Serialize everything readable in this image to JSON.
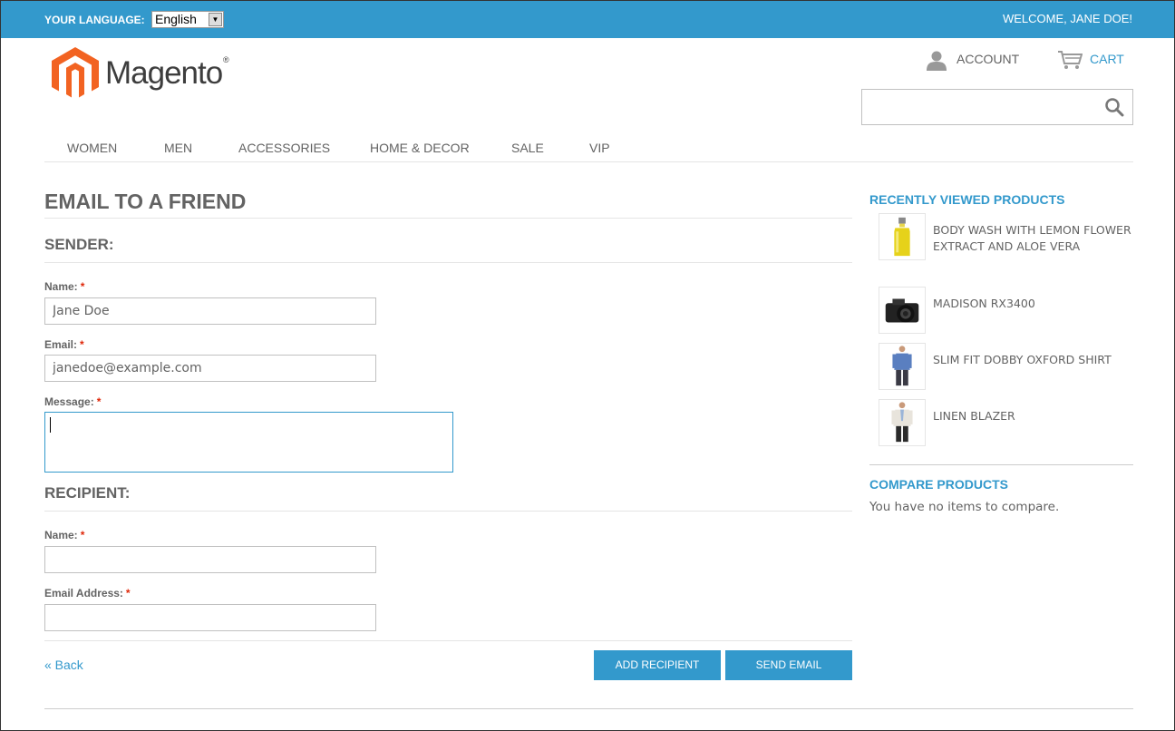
{
  "topbar": {
    "language_label": "YOUR LANGUAGE:",
    "language_value": "English",
    "welcome": "WELCOME, JANE DOE!"
  },
  "header": {
    "logo_text": "Magento",
    "logo_reg": "®",
    "account_label": "ACCOUNT",
    "cart_label": "CART",
    "search_value": ""
  },
  "nav": {
    "items": [
      "WOMEN",
      "MEN",
      "ACCESSORIES",
      "HOME & DECOR",
      "SALE",
      "VIP"
    ]
  },
  "form": {
    "title": "EMAIL TO A FRIEND",
    "sender_title": "SENDER:",
    "sender_name_label": "Name:",
    "sender_name_value": "Jane Doe",
    "sender_email_label": "Email:",
    "sender_email_value": "janedoe@example.com",
    "message_label": "Message:",
    "message_value": "",
    "recipient_title": "RECIPIENT:",
    "recipient_name_label": "Name:",
    "recipient_name_value": "",
    "recipient_email_label": "Email Address:",
    "recipient_email_value": "",
    "required_mark": "*",
    "back_label": "« Back",
    "add_recipient_label": "ADD RECIPIENT",
    "send_email_label": "SEND EMAIL"
  },
  "sidebar": {
    "recently_viewed_title": "RECENTLY VIEWED PRODUCTS",
    "products": [
      {
        "name": "BODY WASH WITH LEMON FLOWER EXTRACT AND ALOE VERA",
        "icon": "bottle-image"
      },
      {
        "name": "MADISON RX3400",
        "icon": "camera-image"
      },
      {
        "name": "SLIM FIT DOBBY OXFORD SHIRT",
        "icon": "shirt-model-image"
      },
      {
        "name": "LINEN BLAZER",
        "icon": "blazer-model-image"
      }
    ],
    "compare_title": "COMPARE PRODUCTS",
    "compare_empty": "You have no items to compare."
  },
  "colors": {
    "accent": "#3399cc",
    "required": "#df280a",
    "text": "#636363"
  }
}
